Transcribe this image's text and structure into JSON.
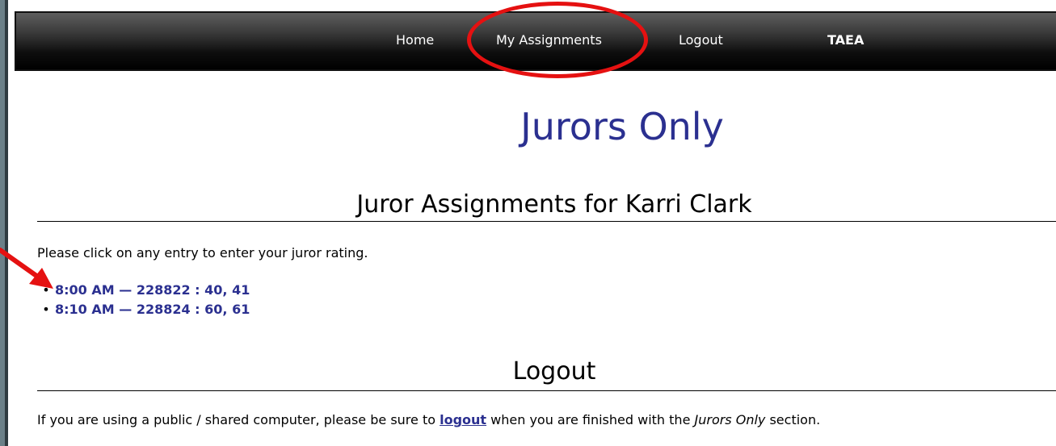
{
  "nav": {
    "items": [
      {
        "label": "Home",
        "bold": false
      },
      {
        "label": "My Assignments",
        "bold": false
      },
      {
        "label": "Logout",
        "bold": false
      },
      {
        "label": "TAEA",
        "bold": true
      }
    ],
    "highlighted": "My Assignments"
  },
  "page": {
    "title": "Jurors Only",
    "assignments_heading": "Juror Assignments for Karri Clark",
    "instructions": "Please click on any entry to enter your juror rating.",
    "assignments": [
      {
        "text": "8:00 AM — 228822 : 40, 41"
      },
      {
        "text": "8:10 AM — 228824 : 60, 61"
      }
    ],
    "logout_heading": "Logout",
    "logout_note": {
      "before": "If you are using a public / shared computer, please be sure to ",
      "link": "logout",
      "middle": " when you are finished with the ",
      "emphasis": "Jurors Only",
      "after": " section."
    }
  },
  "annotations": {
    "highlight_color": "#e51111"
  }
}
